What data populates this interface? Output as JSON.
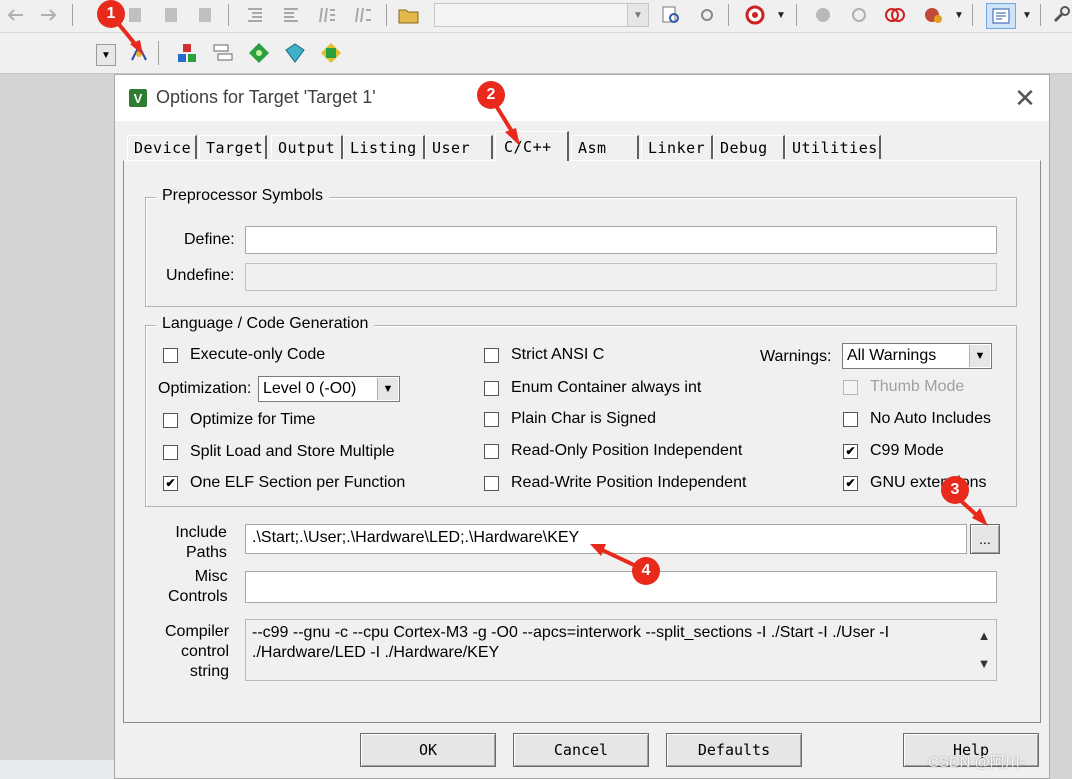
{
  "dialog": {
    "title": "Options for Target 'Target 1'",
    "close_glyph": "✕",
    "icon_letter": "V"
  },
  "tabs": [
    {
      "label": "Device"
    },
    {
      "label": "Target"
    },
    {
      "label": "Output"
    },
    {
      "label": "Listing"
    },
    {
      "label": "User"
    },
    {
      "label": "C/C++",
      "active": true
    },
    {
      "label": "Asm"
    },
    {
      "label": "Linker"
    },
    {
      "label": "Debug"
    },
    {
      "label": "Utilities"
    }
  ],
  "preprocessor": {
    "group_title": "Preprocessor Symbols",
    "define_label": "Define:",
    "define_value": "",
    "undefine_label": "Undefine:",
    "undefine_value": ""
  },
  "language": {
    "group_title": "Language / Code Generation",
    "optimization_label": "Optimization:",
    "optimization_value": "Level 0 (-O0)",
    "warnings_label": "Warnings:",
    "warnings_value": "All Warnings",
    "checkboxes": {
      "execute_only": {
        "label": "Execute-only Code",
        "checked": false
      },
      "optimize_time": {
        "label": "Optimize for Time",
        "checked": false
      },
      "split_load": {
        "label": "Split Load and Store Multiple",
        "checked": false
      },
      "one_elf": {
        "label": "One ELF Section per Function",
        "checked": true
      },
      "strict_ansi": {
        "label": "Strict ANSI C",
        "checked": false
      },
      "enum_container": {
        "label": "Enum Container always int",
        "checked": false
      },
      "plain_char": {
        "label": "Plain Char is Signed",
        "checked": false
      },
      "ro_pi": {
        "label": "Read-Only Position Independent",
        "checked": false
      },
      "rw_pi": {
        "label": "Read-Write Position Independent",
        "checked": false
      },
      "thumb_mode": {
        "label": "Thumb Mode",
        "checked": false,
        "disabled": true
      },
      "no_auto_includes": {
        "label": "No Auto Includes",
        "checked": false
      },
      "c99_mode": {
        "label": "C99 Mode",
        "checked": true
      },
      "gnu_extensions": {
        "label": "GNU extensions",
        "checked": true
      }
    }
  },
  "include": {
    "label_line1": "Include",
    "label_line2": "Paths",
    "value": ".\\Start;.\\User;.\\Hardware\\LED;.\\Hardware\\KEY",
    "browse_label": "..."
  },
  "misc": {
    "label_line1": "Misc",
    "label_line2": "Controls",
    "value": ""
  },
  "compiler": {
    "label_line1": "Compiler",
    "label_line2": "control",
    "label_line3": "string",
    "line1": "--c99 --gnu -c --cpu Cortex-M3 -g -O0 --apcs=interwork --split_sections -I ./Start -I ./User -I",
    "line2": "./Hardware/LED -I ./Hardware/KEY"
  },
  "buttons": {
    "ok": "OK",
    "cancel": "Cancel",
    "defaults": "Defaults",
    "help": "Help"
  },
  "markers": [
    "1",
    "2",
    "3",
    "4"
  ],
  "check_glyph": "✔",
  "watermark": "CSDN @阿川-",
  "colors": {
    "marker_red": "#e8291c",
    "dialog_bg": "#f0f0f0",
    "title_icon_green": "#2e7d32"
  }
}
